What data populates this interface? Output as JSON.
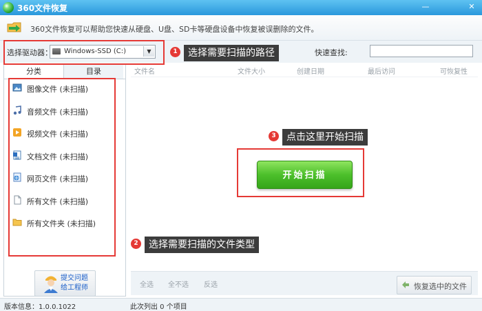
{
  "window": {
    "title": "360文件恢复",
    "min_label": "—",
    "close_label": "✕"
  },
  "tip": {
    "text": "360文件恢复可以帮助您快速从硬盘、U盘、SD卡等硬盘设备中恢复被误删除的文件。"
  },
  "drive": {
    "label": "选择驱动器：",
    "selected": "Windows-SSD (C:)",
    "arrow": "▼"
  },
  "quick_search": {
    "label": "快速查找:",
    "value": ""
  },
  "tabs": [
    {
      "label": "分类"
    },
    {
      "label": "目录"
    }
  ],
  "categories": [
    {
      "label": "图像文件 (未扫描)",
      "icon": "image-file-icon"
    },
    {
      "label": "音频文件 (未扫描)",
      "icon": "audio-file-icon"
    },
    {
      "label": "视频文件 (未扫描)",
      "icon": "video-file-icon"
    },
    {
      "label": "文档文件 (未扫描)",
      "icon": "document-file-icon"
    },
    {
      "label": "网页文件 (未扫描)",
      "icon": "webpage-file-icon"
    },
    {
      "label": "所有文件 (未扫描)",
      "icon": "file-icon"
    },
    {
      "label": "所有文件夹 (未扫描)",
      "icon": "folder-icon"
    }
  ],
  "feedback": {
    "line1": "提交问题",
    "line2": "给工程师"
  },
  "columns": [
    "文件名",
    "文件大小",
    "创建日期",
    "最后访问",
    "可恢复性"
  ],
  "start_button": {
    "label": "开始扫描"
  },
  "selection": {
    "all": "全选",
    "none": "全不选",
    "invert": "反选"
  },
  "recover_button": {
    "label": "恢复选中的文件"
  },
  "status": {
    "version": "版本信息：1.0.0.1022",
    "listed": "此次列出 0 个项目"
  },
  "annotations": [
    {
      "number": "1",
      "text": "选择需要扫描的路径"
    },
    {
      "number": "2",
      "text": "选择需要扫描的文件类型"
    },
    {
      "number": "3",
      "text": "点击这里开始扫描"
    }
  ],
  "colors": {
    "title_bar": "#2a98dc",
    "annotation_red": "#e53935",
    "start_button_green": "#4cbf2b",
    "callout_bg": "#3c3c3c",
    "link_blue": "#1a5ec9"
  }
}
